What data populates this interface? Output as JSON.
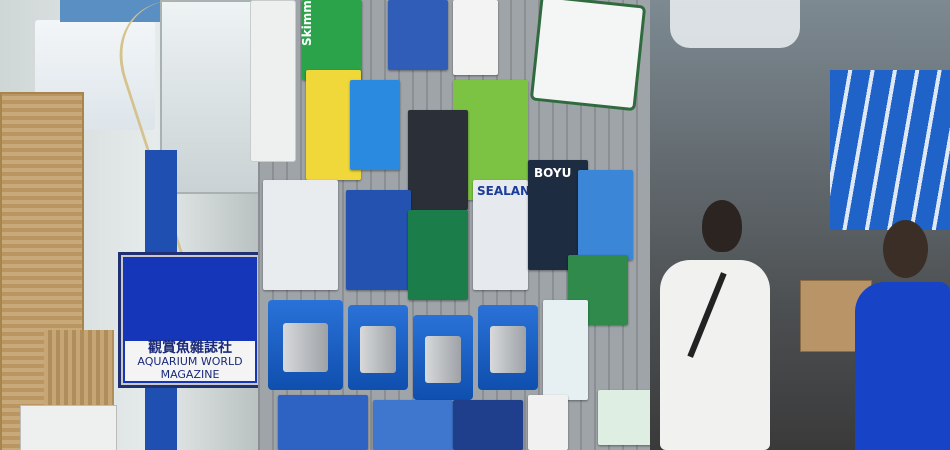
{
  "scene": {
    "description_hint": "",
    "sign": {
      "top_text": "",
      "chinese": "觀賞魚雜誌社",
      "english": "AQUARIUM WORLD MAGAZINE"
    },
    "labels": {
      "skimmer": "Skimmer",
      "sealant": "SEALAN",
      "boyu": "BOYU"
    }
  }
}
